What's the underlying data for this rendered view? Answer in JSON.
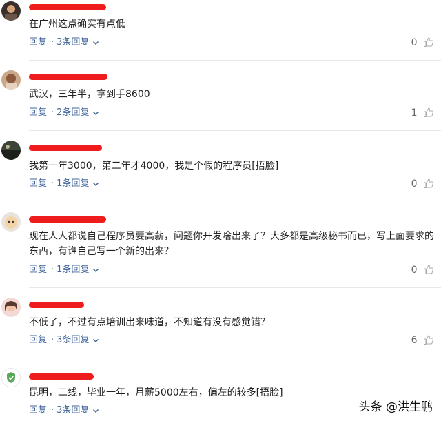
{
  "comments": [
    {
      "text": "在广州这点确实有点低",
      "reply_label": "回复",
      "replies_label": "3条回复",
      "likes": "0"
    },
    {
      "text": "武汉，三年半，拿到手8600",
      "reply_label": "回复",
      "replies_label": "2条回复",
      "likes": "1"
    },
    {
      "text": "我第一年3000，第二年才4000，我是个假的程序员[捂脸]",
      "reply_label": "回复",
      "replies_label": "1条回复",
      "likes": "0"
    },
    {
      "text": "现在人人都说自己程序员要高薪，问题你开发啥出来了？大多都是高级秘书而已，写上面要求的东西，有谁自己写一个新的出来？",
      "reply_label": "回复",
      "replies_label": "1条回复",
      "likes": "0"
    },
    {
      "text": "不低了，不过有点培训出来味道，不知道有没有感觉错？",
      "reply_label": "回复",
      "replies_label": "3条回复",
      "likes": "6"
    },
    {
      "text": "昆明，二线，毕业一年，月薪5000左右，偏左的较多[捂脸]",
      "reply_label": "回复",
      "replies_label": "3条回复",
      "likes": ""
    }
  ],
  "watermark": "头条 @洪生鹏",
  "colors": {
    "link": "#406599",
    "redact": "#ee1c1c",
    "divider": "#e8e8e8"
  }
}
